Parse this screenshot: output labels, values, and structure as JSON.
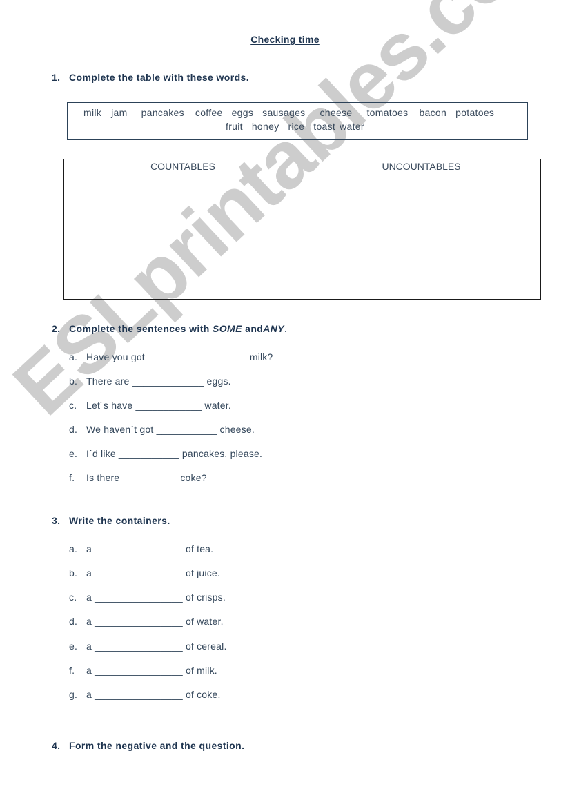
{
  "title": "Checking time",
  "watermark": "ESLprintables.com",
  "section1": {
    "number": "1.",
    "instruction": "Complete the table with these words.",
    "words_line1": [
      "milk",
      "jam",
      "pancakes",
      "coffee",
      "eggs",
      "sausages",
      "cheese",
      "tomatoes",
      "bacon",
      "potatoes"
    ],
    "words_line2": [
      "fruit",
      "honey",
      "rice",
      "toast",
      "water"
    ],
    "table": {
      "headers": [
        "COUNTABLES",
        "UNCOUNTABLES"
      ]
    }
  },
  "section2": {
    "number": "2.",
    "instruction_pre": "Complete the sentences with ",
    "instruction_some": "SOME",
    "instruction_and": " and",
    "instruction_any": "ANY",
    "instruction_end": ".",
    "items": [
      {
        "letter": "a.",
        "text": "Have you got __________________ milk?"
      },
      {
        "letter": "b.",
        "text": "There are _____________ eggs."
      },
      {
        "letter": "c.",
        "text": "Let´s have ____________ water."
      },
      {
        "letter": "d.",
        "text": "We haven´t got ___________ cheese."
      },
      {
        "letter": "e.",
        "text": "I´d like ___________ pancakes, please."
      },
      {
        "letter": "f.",
        "text": "Is there __________ coke?"
      }
    ]
  },
  "section3": {
    "number": "3.",
    "instruction": "Write the containers.",
    "items": [
      {
        "letter": "a.",
        "text": "a ________________ of tea."
      },
      {
        "letter": "b.",
        "text": "a ________________ of juice."
      },
      {
        "letter": "c.",
        "text": "a ________________ of crisps."
      },
      {
        "letter": "d.",
        "text": "a ________________ of water."
      },
      {
        "letter": "e.",
        "text": "a ________________ of cereal."
      },
      {
        "letter": "f.",
        "text": "a ________________ of milk."
      },
      {
        "letter": "g.",
        "text": "a ________________ of coke."
      }
    ]
  },
  "section4": {
    "number": "4.",
    "instruction": "Form the negative and the question."
  }
}
